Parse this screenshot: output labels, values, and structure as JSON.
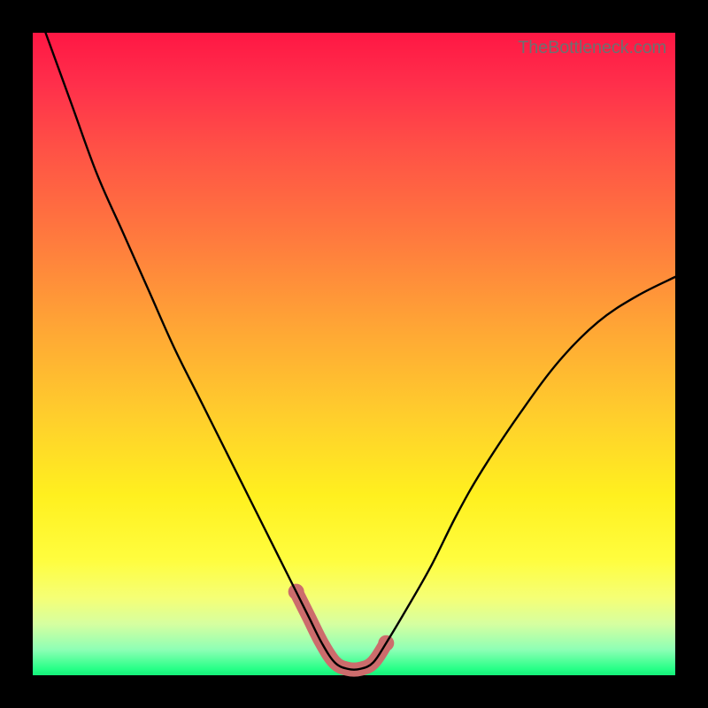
{
  "watermark": "TheBottleneck.com",
  "chart_data": {
    "type": "line",
    "title": "",
    "xlabel": "",
    "ylabel": "",
    "xlim": [
      0,
      100
    ],
    "ylim": [
      0,
      100
    ],
    "series": [
      {
        "name": "bottleneck-curve",
        "x": [
          2,
          6,
          10,
          14,
          18,
          22,
          26,
          30,
          34,
          38,
          41,
          43,
          45,
          47,
          49,
          51,
          53,
          55,
          58,
          62,
          66,
          70,
          76,
          82,
          88,
          94,
          100
        ],
        "values": [
          100,
          89,
          78,
          69,
          60,
          51,
          43,
          35,
          27,
          19,
          13,
          9,
          5,
          2,
          1,
          1,
          2,
          5,
          10,
          17,
          25,
          32,
          41,
          49,
          55,
          59,
          62
        ]
      },
      {
        "name": "highlight-segment",
        "x": [
          41,
          43,
          45,
          47,
          49,
          51,
          53,
          55
        ],
        "values": [
          13,
          9,
          5,
          2,
          1,
          1,
          2,
          5
        ]
      }
    ],
    "colors": {
      "curve": "#000000",
      "highlight_stroke": "#cc6c6c",
      "highlight_fill": "#cc6c6c"
    }
  }
}
